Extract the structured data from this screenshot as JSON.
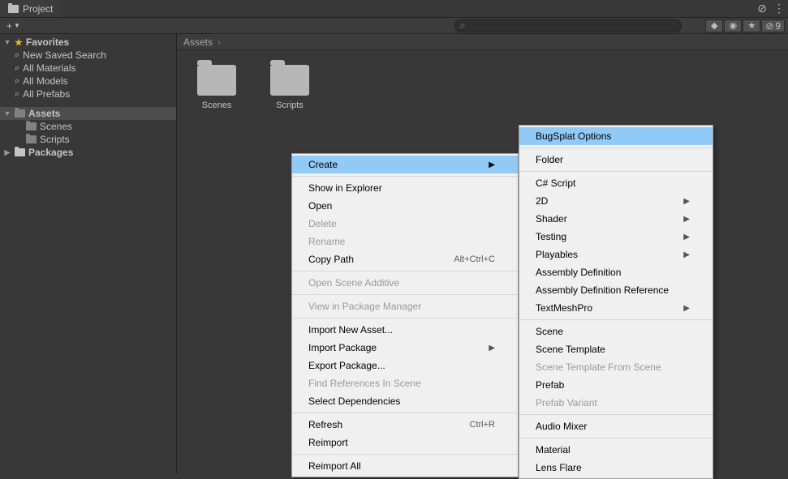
{
  "tab": {
    "title": "Project"
  },
  "topright": {
    "hidden_count": "9"
  },
  "sidebar": {
    "favorites_label": "Favorites",
    "favorites": [
      "New Saved Search",
      "All Materials",
      "All Models",
      "All Prefabs"
    ],
    "assets_label": "Assets",
    "assets_children": [
      "Scenes",
      "Scripts"
    ],
    "packages_label": "Packages"
  },
  "breadcrumb": {
    "root": "Assets"
  },
  "grid_items": [
    "Scenes",
    "Scripts"
  ],
  "context_menu_1": {
    "create": "Create",
    "show_in_explorer": "Show in Explorer",
    "open": "Open",
    "delete": "Delete",
    "rename": "Rename",
    "copy_path": "Copy Path",
    "copy_path_shortcut": "Alt+Ctrl+C",
    "open_scene_additive": "Open Scene Additive",
    "view_in_pm": "View in Package Manager",
    "import_new_asset": "Import New Asset...",
    "import_package": "Import Package",
    "export_package": "Export Package...",
    "find_refs": "Find References In Scene",
    "select_deps": "Select Dependencies",
    "refresh": "Refresh",
    "refresh_shortcut": "Ctrl+R",
    "reimport": "Reimport",
    "reimport_all": "Reimport All"
  },
  "context_menu_2": {
    "bugsplat": "BugSplat Options",
    "folder": "Folder",
    "csharp": "C# Script",
    "two_d": "2D",
    "shader": "Shader",
    "testing": "Testing",
    "playables": "Playables",
    "asm_def": "Assembly Definition",
    "asm_def_ref": "Assembly Definition Reference",
    "tmp": "TextMeshPro",
    "scene": "Scene",
    "scene_template": "Scene Template",
    "scene_template_from": "Scene Template From Scene",
    "prefab": "Prefab",
    "prefab_variant": "Prefab Variant",
    "audio_mixer": "Audio Mixer",
    "material": "Material",
    "lens_flare": "Lens Flare"
  }
}
